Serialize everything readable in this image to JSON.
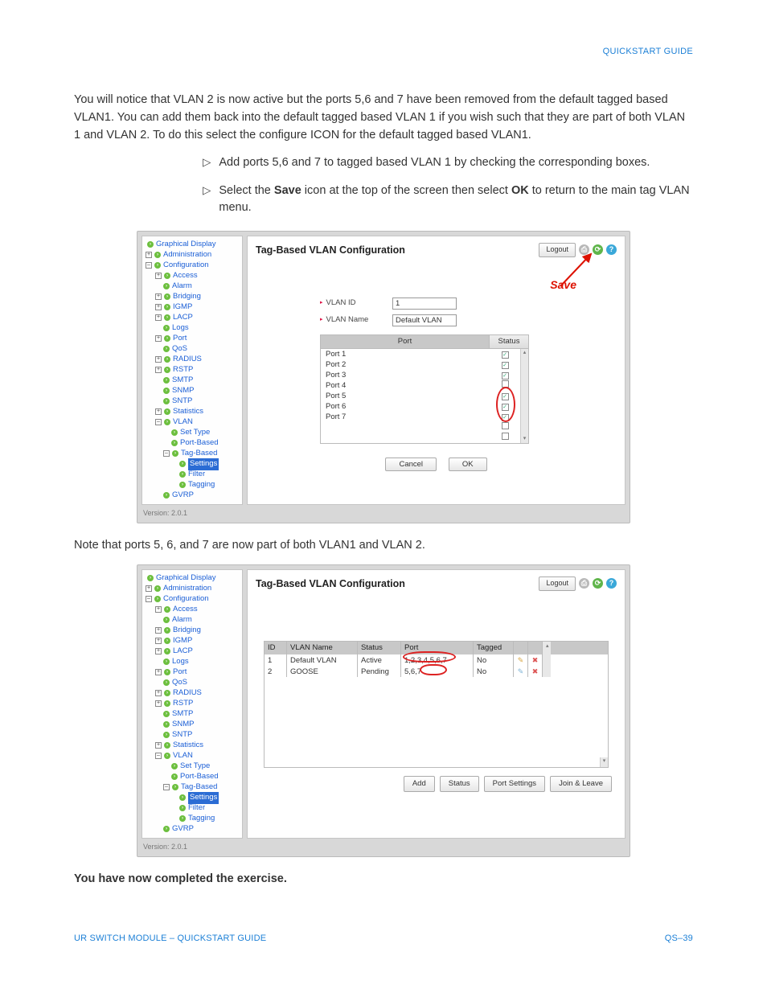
{
  "header": {
    "title": "QUICKSTART GUIDE"
  },
  "body": {
    "intro": "You will notice that VLAN 2 is now active but the ports 5,6 and 7 have been removed from the default tagged based VLAN1. You can add them back into the default tagged based VLAN 1 if you wish such that they are part of both VLAN 1 and VLAN 2. To do this select the configure ICON for the default tagged based VLAN1.",
    "bullet1_a": "Add ports 5,6 and 7 to tagged based VLAN 1 by checking  the corresponding boxes.",
    "bullet2_a": "Select the ",
    "bullet2_b": "Save",
    "bullet2_c": " icon at the top of the screen then select ",
    "bullet2_d": "OK",
    "bullet2_e": " to return to the main tag VLAN menu.",
    "note": "Note that ports 5, 6, and 7 are now part of both VLAN1 and VLAN 2.",
    "done": "You have now completed the exercise."
  },
  "ui": {
    "title": "Tag-Based VLAN Configuration",
    "logout": "Logout",
    "save_annot": "Save",
    "version": "Version: 2.0.1",
    "tree": {
      "graphical": "Graphical Display",
      "administration": "Administration",
      "configuration": "Configuration",
      "access": "Access",
      "alarm": "Alarm",
      "bridging": "Bridging",
      "igmp": "IGMP",
      "lacp": "LACP",
      "logs": "Logs",
      "port": "Port",
      "qos": "QoS",
      "radius": "RADIUS",
      "rstp": "RSTP",
      "smtp": "SMTP",
      "snmp": "SNMP",
      "sntp": "SNTP",
      "statistics": "Statistics",
      "vlan": "VLAN",
      "settype": "Set Type",
      "portbased": "Port-Based",
      "tagbased": "Tag-Based",
      "settings": "Settings",
      "filter": "Filter",
      "tagging": "Tagging",
      "gvrp": "GVRP"
    },
    "form": {
      "vlan_id_lbl": "VLAN ID",
      "vlan_id_val": "1",
      "vlan_name_lbl": "VLAN Name",
      "vlan_name_val": "Default VLAN",
      "port_hdr": "Port",
      "status_hdr": "Status",
      "ports": [
        "Port 1",
        "Port 2",
        "Port 3",
        "Port 4",
        "Port 5",
        "Port 6",
        "Port 7"
      ]
    },
    "btns": {
      "cancel": "Cancel",
      "ok": "OK"
    },
    "grid": {
      "headers": {
        "id": "ID",
        "name": "VLAN Name",
        "status": "Status",
        "port": "Port",
        "tagged": "Tagged"
      },
      "rows": [
        {
          "id": "1",
          "name": "Default VLAN",
          "status": "Active",
          "port": "1,2,3,4,5,6,7",
          "tagged": "No"
        },
        {
          "id": "2",
          "name": "GOOSE",
          "status": "Pending",
          "port": "5,6,7",
          "tagged": "No"
        }
      ]
    },
    "btns2": {
      "add": "Add",
      "status": "Status",
      "port": "Port Settings",
      "join": "Join & Leave"
    }
  },
  "footer": {
    "left": "UR SWITCH MODULE – QUICKSTART GUIDE",
    "right": "QS–39"
  }
}
